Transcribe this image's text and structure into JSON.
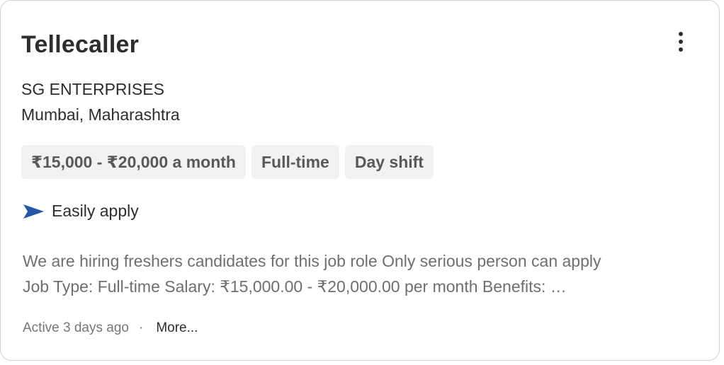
{
  "job": {
    "title": "Tellecaller",
    "company": "SG ENTERPRISES",
    "location": "Mumbai, Maharashtra",
    "tags": [
      "₹15,000 - ₹20,000 a month",
      "Full-time",
      "Day shift"
    ],
    "easy_apply_label": "Easily apply",
    "snippet_lines": [
      "We are hiring freshers candidates for this job role Only serious person can apply",
      "Job Type: Full-time Salary: ₹15,000.00 - ₹20,000.00 per month Benefits: …"
    ],
    "activity": "Active 3 days ago",
    "separator": "·",
    "more_label": "More..."
  },
  "icons": {
    "menu": "more-vertical-icon",
    "easy_apply": "paper-plane-arrow-icon"
  },
  "colors": {
    "text_primary": "#2d2d2d",
    "text_secondary": "#6f6f6f",
    "tag_background": "#f3f2f1",
    "tag_text": "#595959",
    "easy_apply_icon": "#2557a7",
    "card_border": "#d4d2d0"
  }
}
